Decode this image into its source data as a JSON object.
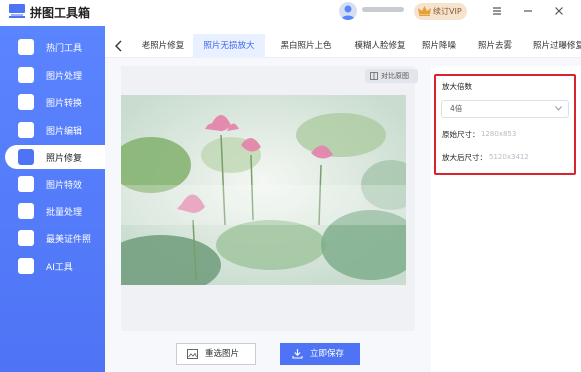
{
  "app": {
    "title": "拼图工具箱",
    "vip_label": "续订VIP"
  },
  "sidebar": {
    "items": [
      {
        "label": "热门工具",
        "icon": "hot-icon",
        "active": false
      },
      {
        "label": "图片处理",
        "icon": "image-process-icon",
        "active": false
      },
      {
        "label": "图片转换",
        "icon": "image-convert-icon",
        "active": false
      },
      {
        "label": "图片编辑",
        "icon": "image-edit-icon",
        "active": false
      },
      {
        "label": "照片修复",
        "icon": "photo-repair-icon",
        "active": true
      },
      {
        "label": "图片特效",
        "icon": "image-effects-icon",
        "active": false
      },
      {
        "label": "批量处理",
        "icon": "batch-icon",
        "active": false
      },
      {
        "label": "最美证件照",
        "icon": "id-photo-icon",
        "active": false
      },
      {
        "label": "AI工具",
        "icon": "ai-icon",
        "active": false
      }
    ]
  },
  "tabs": [
    {
      "label": "老照片修复",
      "active": false
    },
    {
      "label": "照片无损放大",
      "active": true
    },
    {
      "label": "黑白照片上色",
      "active": false
    },
    {
      "label": "模糊人脸修复",
      "active": false
    },
    {
      "label": "照片降噪",
      "active": false
    },
    {
      "label": "照片去雾",
      "active": false
    },
    {
      "label": "照片过曝修复",
      "active": false
    }
  ],
  "preview": {
    "compare_label": "对比原图"
  },
  "actions": {
    "reselect_label": "重选图片",
    "save_label": "立即保存"
  },
  "settings": {
    "scale_label": "放大倍数",
    "scale_value": "4倍",
    "original_size_label": "原始尺寸：",
    "original_size_value": "1280x853",
    "enlarged_size_label": "放大后尺寸：",
    "enlarged_size_value": "5120x3412"
  },
  "colors": {
    "accent": "#4e74f5",
    "highlight": "#d9232e",
    "active_tab_bg": "#e9f0ff"
  }
}
